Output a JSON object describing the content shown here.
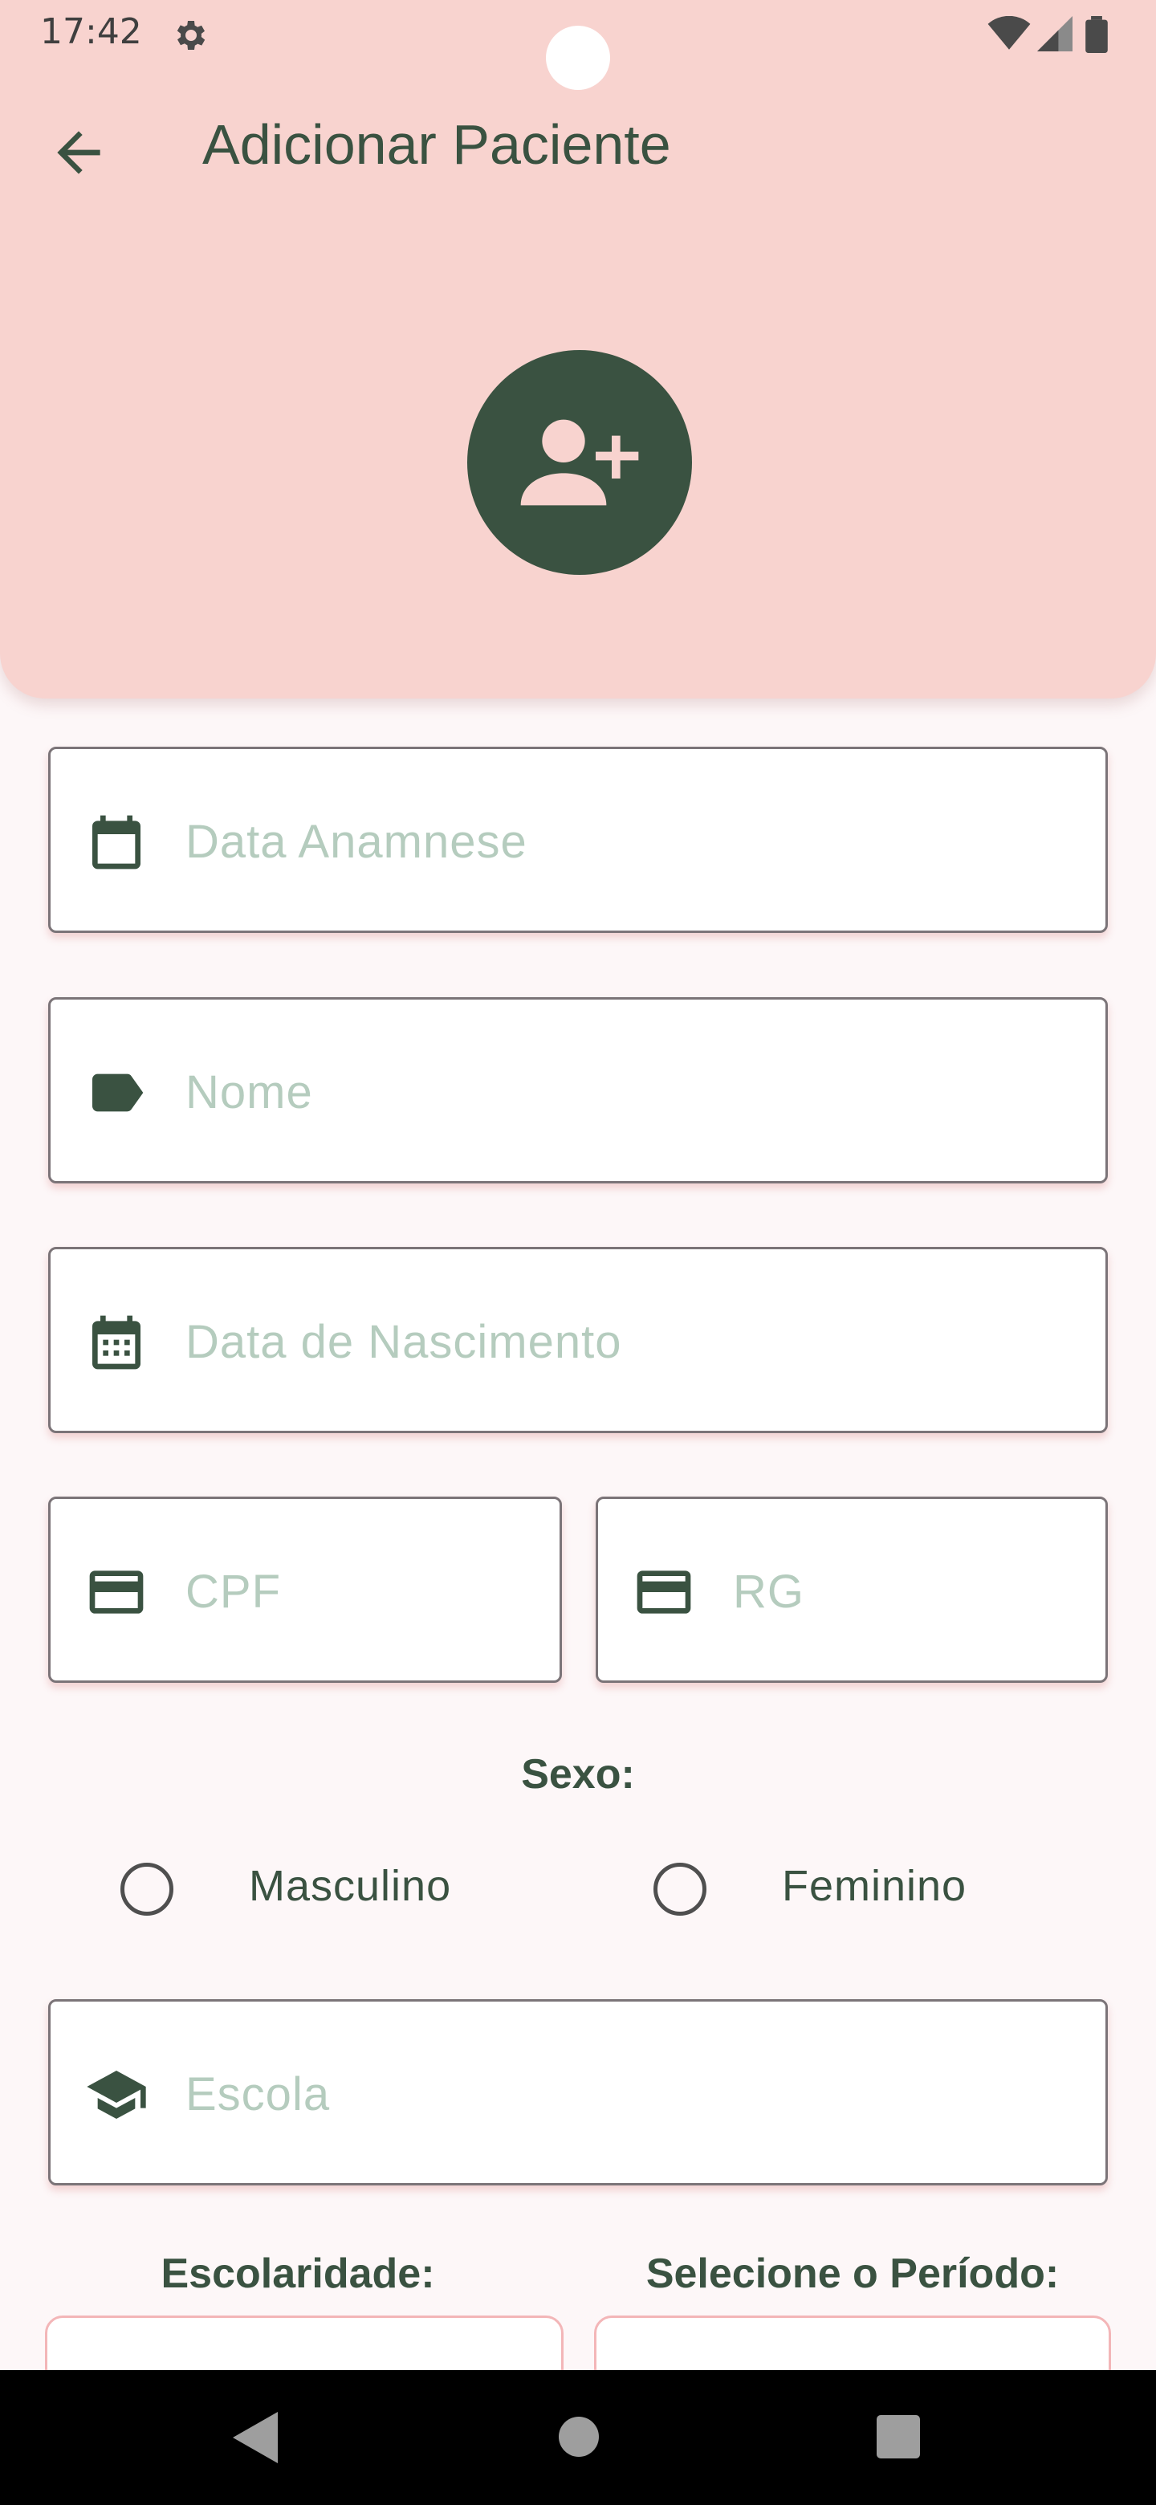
{
  "status_bar": {
    "time": "17:42"
  },
  "app_bar": {
    "title": "Adicionar Paciente"
  },
  "form": {
    "data_anamnese_placeholder": "Data Anamnese",
    "nome_placeholder": "Nome",
    "data_nascimento_placeholder": "Data de Nascimento",
    "cpf_placeholder": "CPF",
    "rg_placeholder": "RG",
    "sexo_label": "Sexo:",
    "sexo_options": [
      "Masculino",
      "Feminino"
    ],
    "escola_placeholder": "Escola",
    "escolaridade_label": "Escolaridade:",
    "periodo_label": "Selecione o Período:"
  },
  "colors": {
    "header_bg": "#f8d3cf",
    "primary": "#3a5241",
    "placeholder": "#b5ccbe"
  }
}
